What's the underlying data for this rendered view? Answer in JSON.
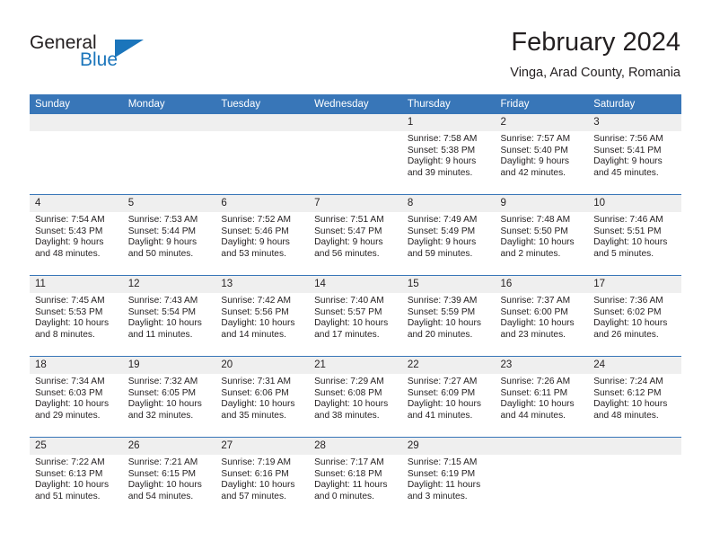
{
  "brand": {
    "name_part1": "General",
    "name_part2": "Blue",
    "accent_color": "#1b75bb"
  },
  "header": {
    "title": "February 2024",
    "location": "Vinga, Arad County, Romania"
  },
  "theme": {
    "header_blue": "#3876b8",
    "daynum_band": "#efefef",
    "text": "#231f20"
  },
  "weekdays": [
    "Sunday",
    "Monday",
    "Tuesday",
    "Wednesday",
    "Thursday",
    "Friday",
    "Saturday"
  ],
  "weeks": [
    [
      {
        "day": "",
        "lines": []
      },
      {
        "day": "",
        "lines": []
      },
      {
        "day": "",
        "lines": []
      },
      {
        "day": "",
        "lines": []
      },
      {
        "day": "1",
        "lines": [
          "Sunrise: 7:58 AM",
          "Sunset: 5:38 PM",
          "Daylight: 9 hours",
          "and 39 minutes."
        ]
      },
      {
        "day": "2",
        "lines": [
          "Sunrise: 7:57 AM",
          "Sunset: 5:40 PM",
          "Daylight: 9 hours",
          "and 42 minutes."
        ]
      },
      {
        "day": "3",
        "lines": [
          "Sunrise: 7:56 AM",
          "Sunset: 5:41 PM",
          "Daylight: 9 hours",
          "and 45 minutes."
        ]
      }
    ],
    [
      {
        "day": "4",
        "lines": [
          "Sunrise: 7:54 AM",
          "Sunset: 5:43 PM",
          "Daylight: 9 hours",
          "and 48 minutes."
        ]
      },
      {
        "day": "5",
        "lines": [
          "Sunrise: 7:53 AM",
          "Sunset: 5:44 PM",
          "Daylight: 9 hours",
          "and 50 minutes."
        ]
      },
      {
        "day": "6",
        "lines": [
          "Sunrise: 7:52 AM",
          "Sunset: 5:46 PM",
          "Daylight: 9 hours",
          "and 53 minutes."
        ]
      },
      {
        "day": "7",
        "lines": [
          "Sunrise: 7:51 AM",
          "Sunset: 5:47 PM",
          "Daylight: 9 hours",
          "and 56 minutes."
        ]
      },
      {
        "day": "8",
        "lines": [
          "Sunrise: 7:49 AM",
          "Sunset: 5:49 PM",
          "Daylight: 9 hours",
          "and 59 minutes."
        ]
      },
      {
        "day": "9",
        "lines": [
          "Sunrise: 7:48 AM",
          "Sunset: 5:50 PM",
          "Daylight: 10 hours",
          "and 2 minutes."
        ]
      },
      {
        "day": "10",
        "lines": [
          "Sunrise: 7:46 AM",
          "Sunset: 5:51 PM",
          "Daylight: 10 hours",
          "and 5 minutes."
        ]
      }
    ],
    [
      {
        "day": "11",
        "lines": [
          "Sunrise: 7:45 AM",
          "Sunset: 5:53 PM",
          "Daylight: 10 hours",
          "and 8 minutes."
        ]
      },
      {
        "day": "12",
        "lines": [
          "Sunrise: 7:43 AM",
          "Sunset: 5:54 PM",
          "Daylight: 10 hours",
          "and 11 minutes."
        ]
      },
      {
        "day": "13",
        "lines": [
          "Sunrise: 7:42 AM",
          "Sunset: 5:56 PM",
          "Daylight: 10 hours",
          "and 14 minutes."
        ]
      },
      {
        "day": "14",
        "lines": [
          "Sunrise: 7:40 AM",
          "Sunset: 5:57 PM",
          "Daylight: 10 hours",
          "and 17 minutes."
        ]
      },
      {
        "day": "15",
        "lines": [
          "Sunrise: 7:39 AM",
          "Sunset: 5:59 PM",
          "Daylight: 10 hours",
          "and 20 minutes."
        ]
      },
      {
        "day": "16",
        "lines": [
          "Sunrise: 7:37 AM",
          "Sunset: 6:00 PM",
          "Daylight: 10 hours",
          "and 23 minutes."
        ]
      },
      {
        "day": "17",
        "lines": [
          "Sunrise: 7:36 AM",
          "Sunset: 6:02 PM",
          "Daylight: 10 hours",
          "and 26 minutes."
        ]
      }
    ],
    [
      {
        "day": "18",
        "lines": [
          "Sunrise: 7:34 AM",
          "Sunset: 6:03 PM",
          "Daylight: 10 hours",
          "and 29 minutes."
        ]
      },
      {
        "day": "19",
        "lines": [
          "Sunrise: 7:32 AM",
          "Sunset: 6:05 PM",
          "Daylight: 10 hours",
          "and 32 minutes."
        ]
      },
      {
        "day": "20",
        "lines": [
          "Sunrise: 7:31 AM",
          "Sunset: 6:06 PM",
          "Daylight: 10 hours",
          "and 35 minutes."
        ]
      },
      {
        "day": "21",
        "lines": [
          "Sunrise: 7:29 AM",
          "Sunset: 6:08 PM",
          "Daylight: 10 hours",
          "and 38 minutes."
        ]
      },
      {
        "day": "22",
        "lines": [
          "Sunrise: 7:27 AM",
          "Sunset: 6:09 PM",
          "Daylight: 10 hours",
          "and 41 minutes."
        ]
      },
      {
        "day": "23",
        "lines": [
          "Sunrise: 7:26 AM",
          "Sunset: 6:11 PM",
          "Daylight: 10 hours",
          "and 44 minutes."
        ]
      },
      {
        "day": "24",
        "lines": [
          "Sunrise: 7:24 AM",
          "Sunset: 6:12 PM",
          "Daylight: 10 hours",
          "and 48 minutes."
        ]
      }
    ],
    [
      {
        "day": "25",
        "lines": [
          "Sunrise: 7:22 AM",
          "Sunset: 6:13 PM",
          "Daylight: 10 hours",
          "and 51 minutes."
        ]
      },
      {
        "day": "26",
        "lines": [
          "Sunrise: 7:21 AM",
          "Sunset: 6:15 PM",
          "Daylight: 10 hours",
          "and 54 minutes."
        ]
      },
      {
        "day": "27",
        "lines": [
          "Sunrise: 7:19 AM",
          "Sunset: 6:16 PM",
          "Daylight: 10 hours",
          "and 57 minutes."
        ]
      },
      {
        "day": "28",
        "lines": [
          "Sunrise: 7:17 AM",
          "Sunset: 6:18 PM",
          "Daylight: 11 hours",
          "and 0 minutes."
        ]
      },
      {
        "day": "29",
        "lines": [
          "Sunrise: 7:15 AM",
          "Sunset: 6:19 PM",
          "Daylight: 11 hours",
          "and 3 minutes."
        ]
      },
      {
        "day": "",
        "lines": []
      },
      {
        "day": "",
        "lines": []
      }
    ]
  ]
}
